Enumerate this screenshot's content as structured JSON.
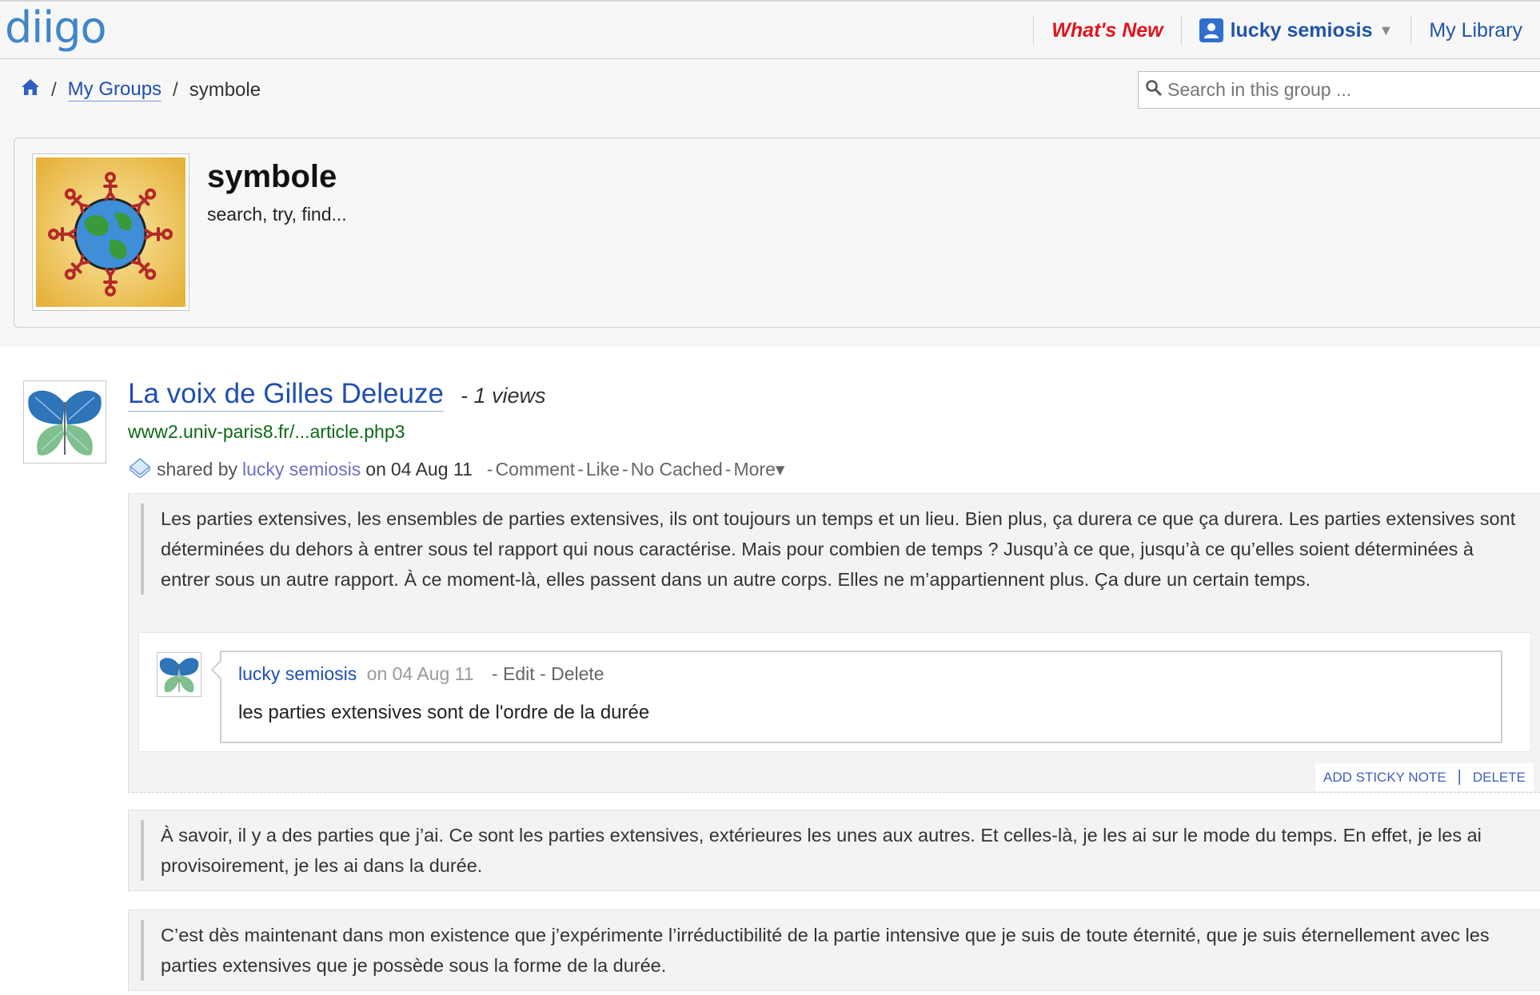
{
  "topbar": {
    "logo": "diigo",
    "whats_new": "What's New",
    "user_name": "lucky semiosis",
    "my_library": "My Library"
  },
  "breadcrumb": {
    "my_groups": "My Groups",
    "current": "symbole",
    "separator": "/"
  },
  "search": {
    "placeholder": "Search in this group ..."
  },
  "group": {
    "title": "symbole",
    "description": "search, try, find..."
  },
  "bookmark": {
    "title": "La voix de Gilles Deleuze",
    "views": "- 1 views",
    "url": "www2.univ-paris8.fr/...article.php3",
    "shared_by_label": "shared by",
    "shared_by_user": "lucky semiosis",
    "on_label": "on",
    "date": "04 Aug 11",
    "actions": {
      "comment": "Comment",
      "like": "Like",
      "no_cached": "No Cached",
      "more": "More▾"
    }
  },
  "highlights": [
    {
      "text": "Les parties extensives, les ensembles de parties extensives, ils ont toujours un temps et un lieu. Bien plus, ça durera ce que ça durera. Les parties extensives sont déterminées du dehors à entrer sous tel rapport qui nous caractérise. Mais pour combien de temps ? Jusqu’à ce que, jusqu’à ce qu’elles soient déterminées à entrer sous un autre rapport. À ce moment-là, elles passent dans un autre corps. Elles ne m’appartiennent plus. Ça dure un certain temps.",
      "annotation": {
        "user": "lucky semiosis",
        "on_date": "on 04 Aug 11",
        "edit": "Edit",
        "delete": "Delete",
        "text": "les parties extensives sont de l'ordre de la durée"
      },
      "add_sticky_note": "ADD STICKY NOTE",
      "delete": "DELETE"
    },
    {
      "text": "À savoir, il y a des parties que j’ai. Ce sont les parties extensives, extérieures les unes aux autres. Et celles-là, je les ai sur le mode du temps. En effet, je les ai provisoirement, je les ai dans la durée."
    },
    {
      "text": "C’est dès maintenant dans mon existence que j’expérimente l’irréductibilité de la partie intensive que je suis de toute éternité, que je suis éternellement avec les parties extensives que je possède sous la forme de la durée."
    }
  ],
  "icons": {
    "home": "home-icon",
    "search": "search-icon",
    "user": "user-icon",
    "shared": "shared-bookmark-icon",
    "brand_color": "#3f86c8",
    "link_color": "#1f4fb3",
    "alert_color": "#e0141e",
    "url_color": "#0b6a14"
  }
}
